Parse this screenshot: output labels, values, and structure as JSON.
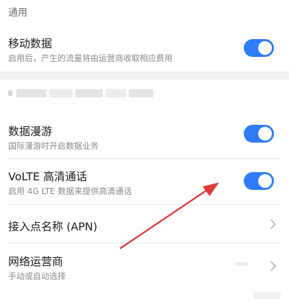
{
  "sections": [
    {
      "header": "通用"
    }
  ],
  "rows": {
    "mobile_data": {
      "title": "移动数据",
      "subtitle": "启用后，产生的流量将由运营商收取相应费用",
      "toggle_on": true
    },
    "data_roaming": {
      "title": "数据漫游",
      "subtitle": "国际漫游时开启数据业务",
      "toggle_on": true
    },
    "volte": {
      "title": "VoLTE 高清通话",
      "subtitle": "启用 4G LTE 数据来提供高清通话",
      "toggle_on": true
    },
    "apn": {
      "title": "接入点名称 (APN)"
    },
    "carrier": {
      "title": "网络运营商",
      "subtitle": "手动或自动选择"
    }
  },
  "colors": {
    "accent": "#2f7df6",
    "annotation_arrow": "#e03a3a"
  },
  "icons": [
    "chevron-right-icon",
    "toggle-switch-icon"
  ]
}
